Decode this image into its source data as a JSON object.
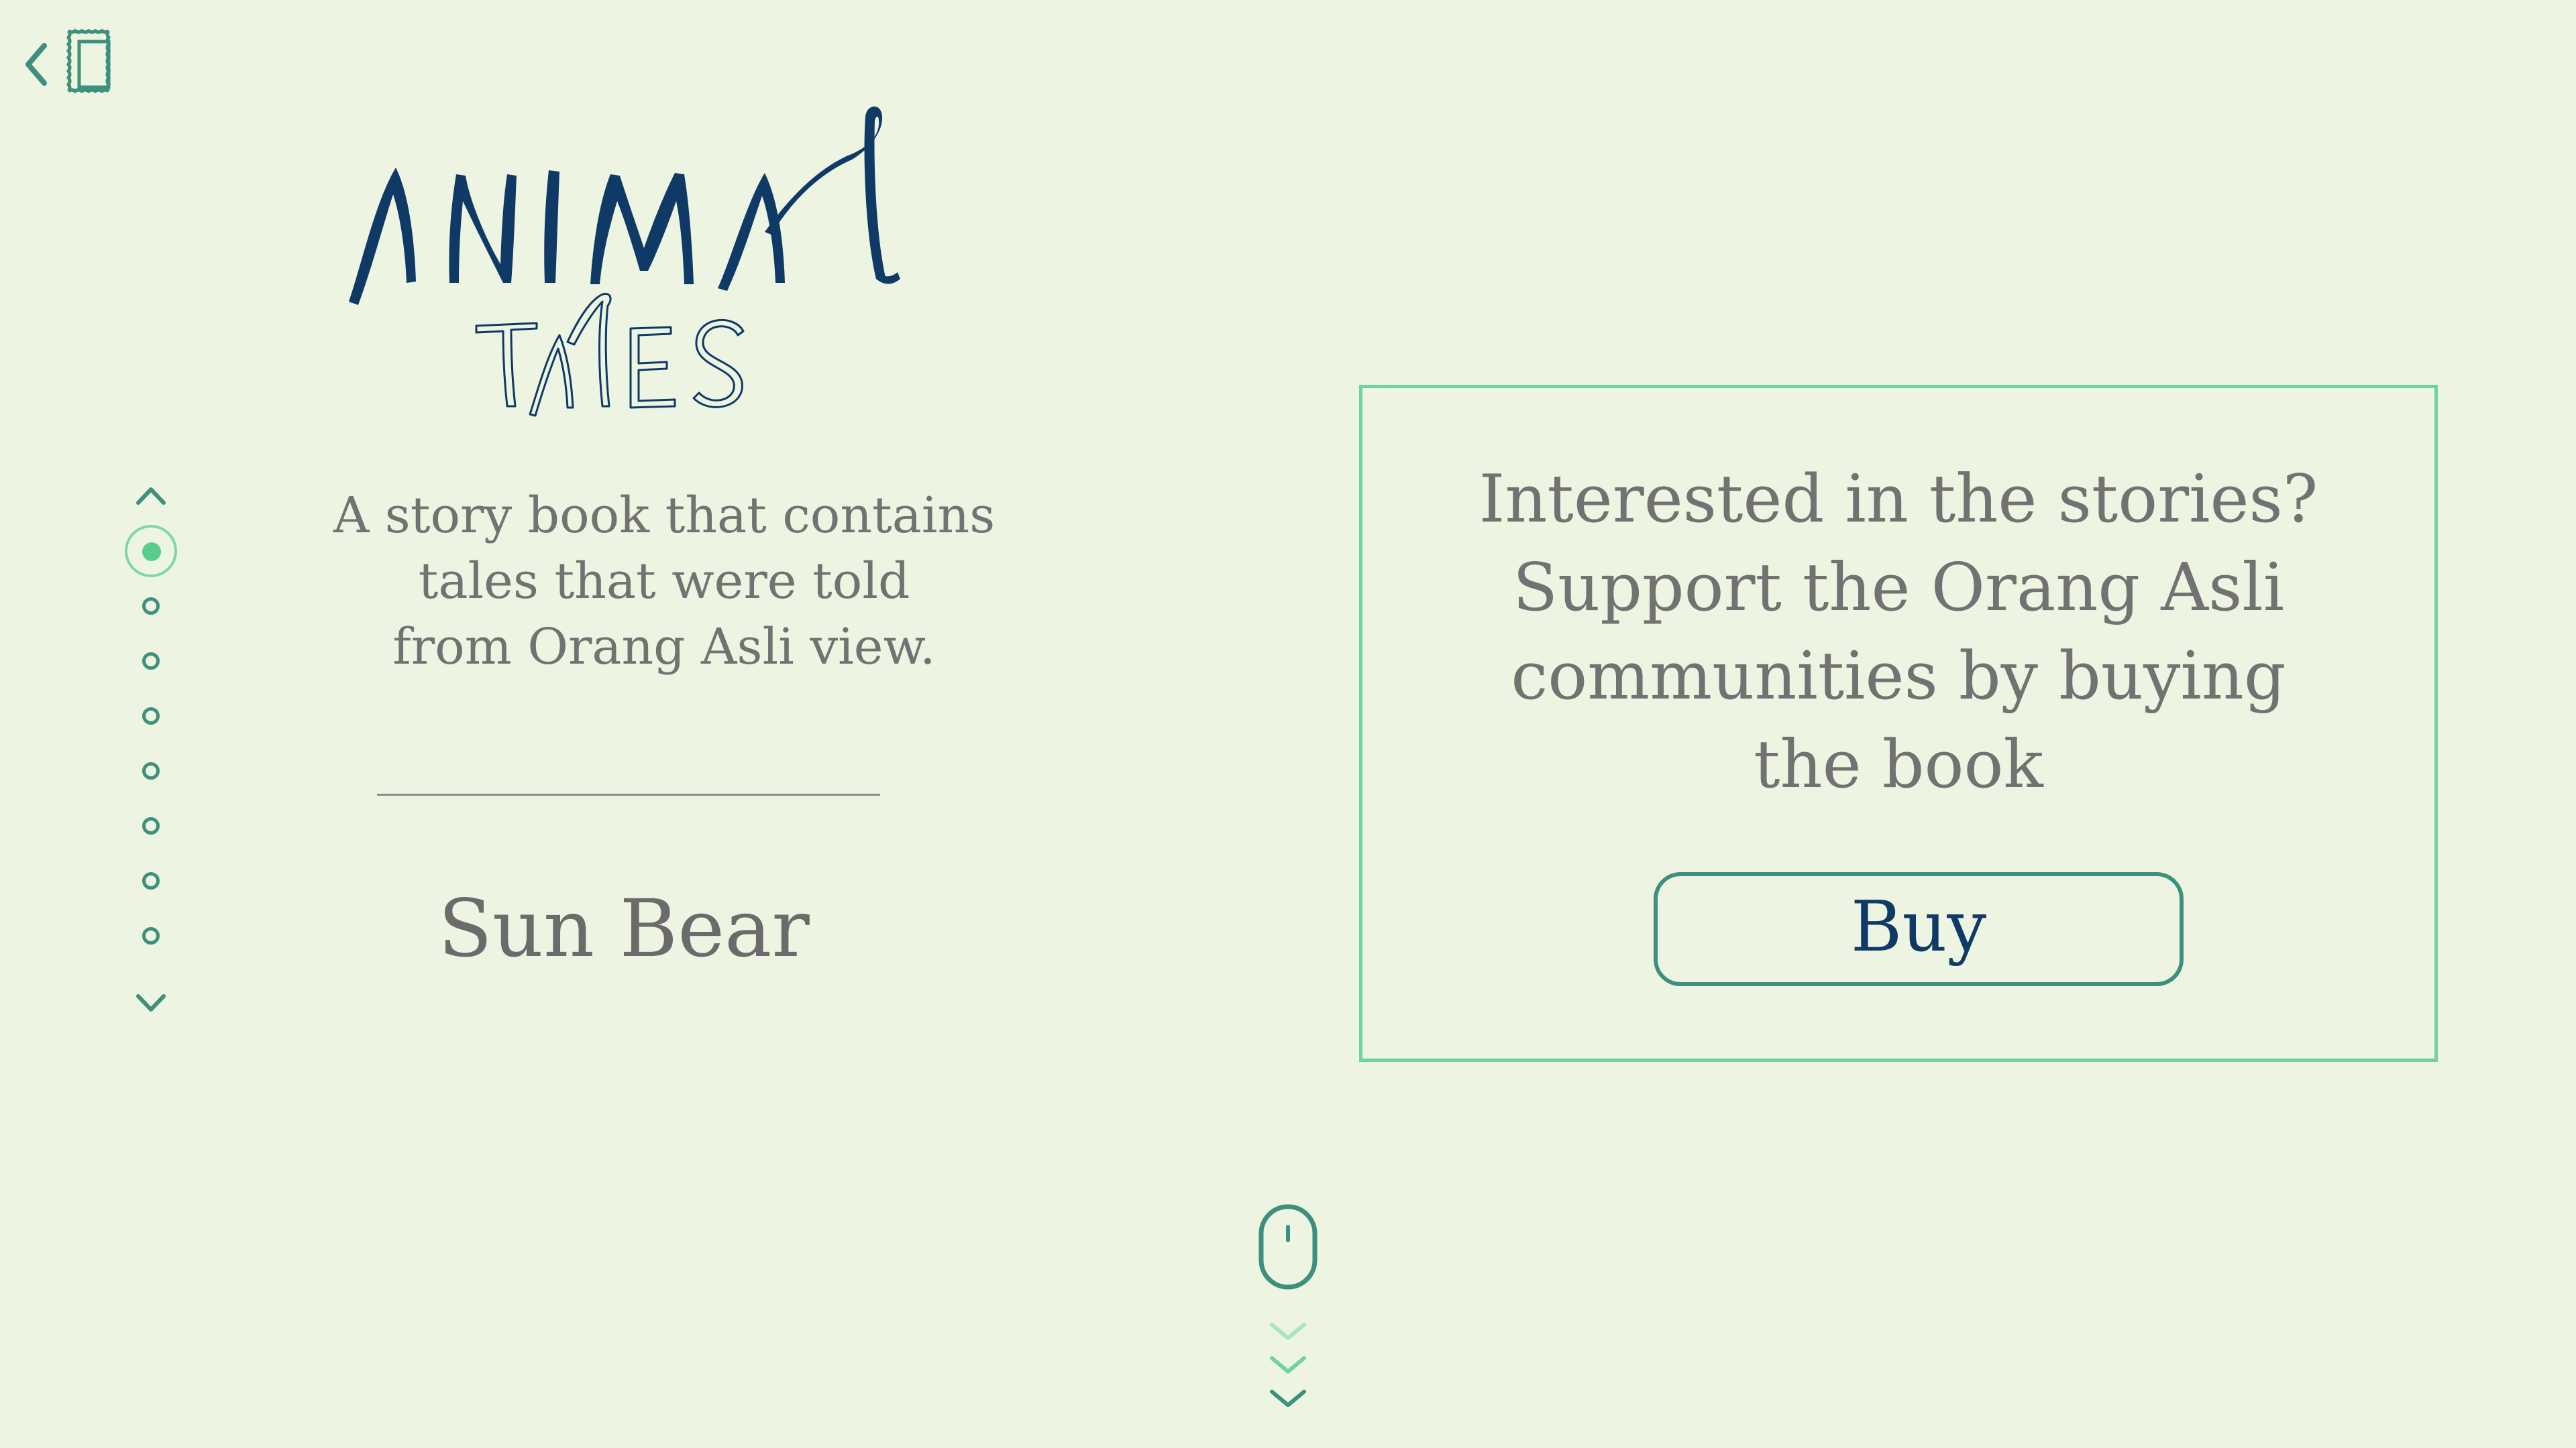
{
  "page": {
    "background": "#edf4e1"
  },
  "header": {
    "back_icon": "chevron-left-icon",
    "frame_icon": "picture-frame-icon"
  },
  "logo": {
    "line1": "ANIMAL",
    "line2": "TALES",
    "line1_color": "#0f3a66",
    "line2_color": "#0f3a66"
  },
  "intro": {
    "description": "A story book that contains\ntales that were told\nfrom Orang Asli view.",
    "story_title": "Sun Bear"
  },
  "pager": {
    "up_icon": "chevron-up-icon",
    "down_icon": "chevron-down-icon",
    "total": 8,
    "active_index": 0,
    "dot_color": "#3f8f7d",
    "active_color": "#56cf8a"
  },
  "purchase": {
    "message": "Interested in the stories?\nSupport the Orang Asli\ncommunities by buying\nthe book",
    "buy_label": "Buy",
    "border_color": "#6fd49c",
    "button_border_color": "#3f8f7d",
    "button_text_color": "#0f3a66"
  },
  "scroll_hint": {
    "mouse_icon": "mouse-icon",
    "arrows_icon": "triple-chevron-down-icon"
  }
}
